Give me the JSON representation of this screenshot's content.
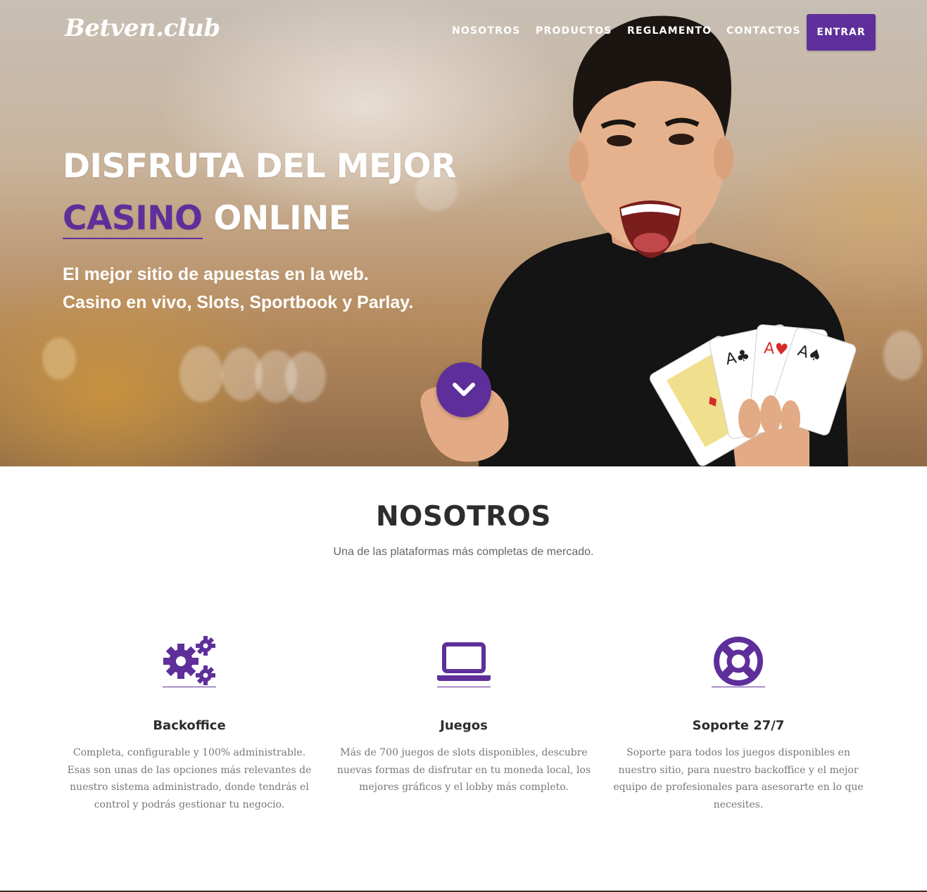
{
  "brand": {
    "logo": "Betven.club",
    "accent_color": "#5e2f9a"
  },
  "nav": {
    "items": [
      "NOSOTROS",
      "PRODUCTOS",
      "REGLAMENTO",
      "CONTACTOS"
    ],
    "login_label": "ENTRAR"
  },
  "hero": {
    "title_line1": "DISFRUTA DEL MEJOR",
    "title_accent": "CASINO",
    "title_rest": " ONLINE",
    "subtitle_line1": "El mejor sitio de apuestas en la web.",
    "subtitle_line2": "Casino en vivo, Slots, Sportbook y Parlay.",
    "scroll_icon": "chevron-down-icon"
  },
  "about": {
    "title": "NOSOTROS",
    "subtitle": "Una de las plataformas más completas de mercado.",
    "features": [
      {
        "icon": "gears-icon",
        "title": "Backoffice",
        "text": "Completa, configurable y 100% administrable. Esas son unas de las opciones más relevantes de nuestro sistema administrado, donde tendrás el control y podrás gestionar tu negocio."
      },
      {
        "icon": "laptop-icon",
        "title": "Juegos",
        "text": "Más de 700 juegos de slots disponibles, descubre nuevas formas de disfrutar en tu moneda local, los mejores gráficos y el lobby más completo."
      },
      {
        "icon": "life-ring-icon",
        "title": "Soporte 27/7",
        "text": "Soporte para todos los juegos disponibles en nuestro sitio, para nuestro backoffice y el mejor equipo de profesionales para asesorarte en lo que necesites."
      }
    ]
  }
}
